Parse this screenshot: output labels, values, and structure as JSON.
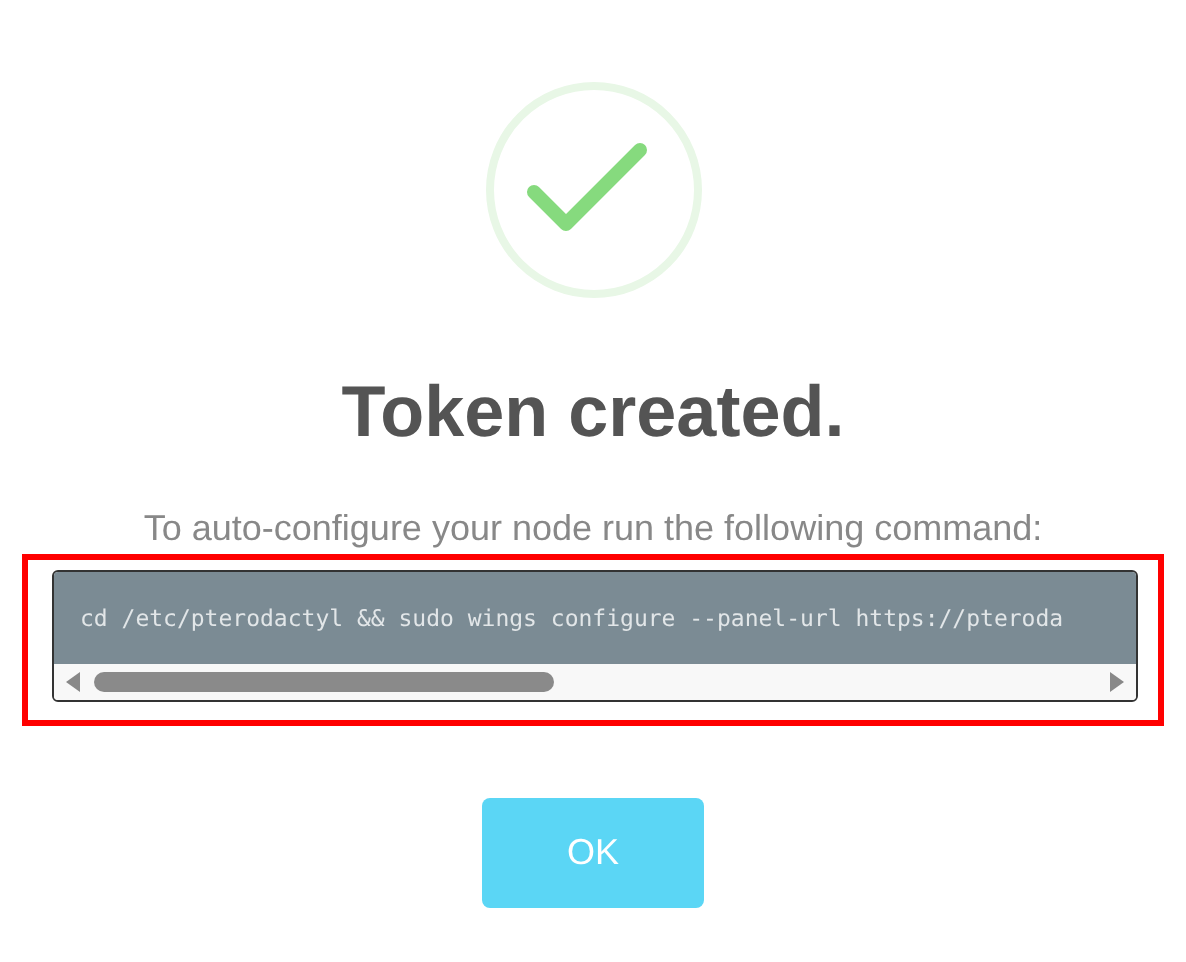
{
  "dialog": {
    "title": "Token created.",
    "message": "To auto-configure your node run the following command:",
    "command": "cd /etc/pterodactyl && sudo wings configure --panel-url https://pteroda",
    "highlighted": true,
    "button": "OK"
  }
}
